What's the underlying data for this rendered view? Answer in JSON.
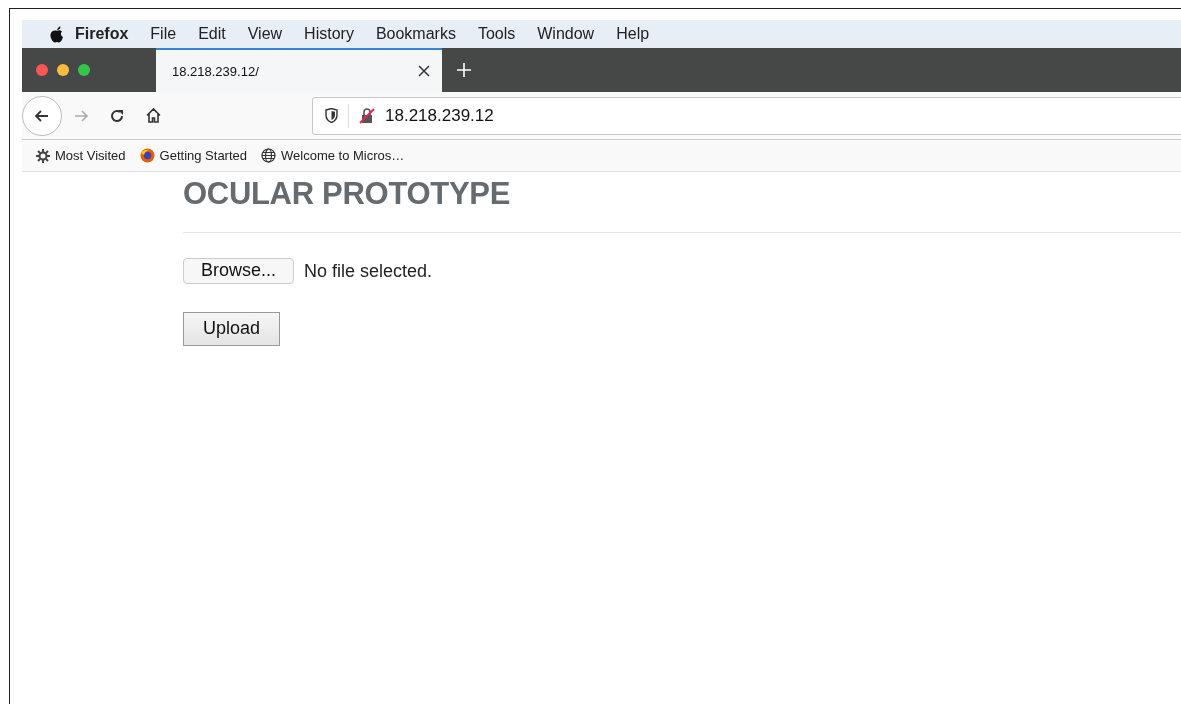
{
  "menu_bar": {
    "app_name": "Firefox",
    "menus": [
      "File",
      "Edit",
      "View",
      "History",
      "Bookmarks",
      "Tools",
      "Window",
      "Help"
    ]
  },
  "tabs": [
    {
      "title": "18.218.239.12/",
      "selected": true
    }
  ],
  "nav_buttons": [
    {
      "kind": "back",
      "disabled": false
    },
    {
      "kind": "forward",
      "disabled": true
    },
    {
      "kind": "reload",
      "disabled": false
    },
    {
      "kind": "home",
      "disabled": false
    }
  ],
  "address_bar": {
    "url": "18.218.239.12"
  },
  "bookmarks": [
    {
      "kind": "gear",
      "label": "Most Visited"
    },
    {
      "kind": "firefox",
      "label": "Getting Started"
    },
    {
      "kind": "globe",
      "label": "Welcome to Micros…"
    }
  ],
  "page": {
    "heading": "OCULAR PROTOTYPE",
    "browse_button": "Browse...",
    "file_status": "No file selected.",
    "upload_button": "Upload"
  }
}
